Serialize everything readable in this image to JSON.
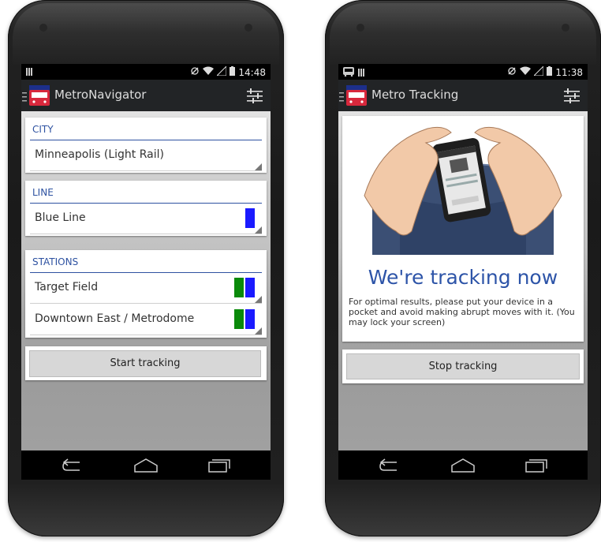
{
  "left_phone": {
    "status": {
      "time": "14:48"
    },
    "actionbar": {
      "title": "MetroNavigator"
    },
    "city": {
      "header": "CITY",
      "value": "Minneapolis (Light Rail)"
    },
    "line": {
      "header": "LINE",
      "value": "Blue Line",
      "color": "#1a1aff"
    },
    "stations": {
      "header": "STATIONS",
      "items": [
        {
          "name": "Target Field",
          "colors": [
            "#0a8a0a",
            "#1a1aff"
          ]
        },
        {
          "name": "Downtown East / Metrodome",
          "colors": [
            "#0a8a0a",
            "#1a1aff"
          ]
        }
      ]
    },
    "start_button": "Start tracking"
  },
  "right_phone": {
    "status": {
      "time": "11:38"
    },
    "actionbar": {
      "title": "Metro Tracking"
    },
    "tracking": {
      "title": "We're tracking now",
      "description": "For optimal results, please put your device in a pocket and avoid making abrupt moves with it. (You may lock your screen)"
    },
    "stop_button": "Stop tracking"
  },
  "colors": {
    "accent": "#2e52a1",
    "actionbar": "#222426",
    "app_icon_red": "#d8283c"
  },
  "icons": {
    "navigation": [
      "back-icon",
      "home-icon",
      "recent-apps-icon"
    ],
    "actionbar": [
      "drawer-icon",
      "app-icon",
      "settings-sliders-icon"
    ],
    "statusbar": [
      "signal-icon",
      "sync-icon",
      "wifi-icon",
      "cell-signal-icon",
      "battery-icon",
      "bus-icon"
    ]
  }
}
